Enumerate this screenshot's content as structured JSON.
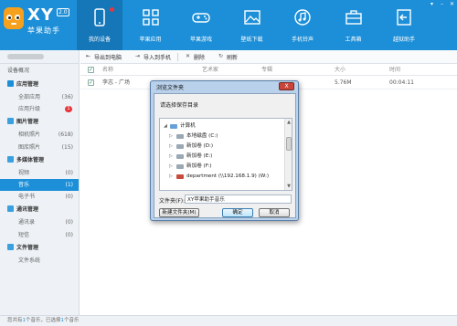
{
  "app": {
    "logo_name": "XY",
    "logo_version": "2.0",
    "logo_subtitle": "苹果助手"
  },
  "nav": [
    {
      "label": "我的设备",
      "icon": "phone-icon",
      "active": true
    },
    {
      "label": "苹果应用",
      "icon": "apps-grid-icon",
      "active": false
    },
    {
      "label": "苹果游戏",
      "icon": "gamepad-icon",
      "active": false
    },
    {
      "label": "壁纸下载",
      "icon": "image-icon",
      "active": false
    },
    {
      "label": "手机铃声",
      "icon": "music-note-icon",
      "active": false
    },
    {
      "label": "工具箱",
      "icon": "toolbox-icon",
      "active": false
    },
    {
      "label": "越狱助手",
      "icon": "exit-arrow-icon",
      "active": false
    }
  ],
  "sidebar": {
    "overview": "设备概况",
    "sections": [
      {
        "title": "应用管理",
        "items": [
          {
            "label": "全部应用",
            "count": "(36)"
          },
          {
            "label": "应用升级",
            "badge": "1"
          }
        ]
      },
      {
        "title": "图片管理",
        "items": [
          {
            "label": "相机照片",
            "count": "(618)"
          },
          {
            "label": "图库照片",
            "count": "(15)"
          }
        ]
      },
      {
        "title": "多媒体管理",
        "items": [
          {
            "label": "视频",
            "count": "(0)"
          },
          {
            "label": "音乐",
            "count": "(1)",
            "active": true
          },
          {
            "label": "电子书",
            "count": "(0)"
          }
        ]
      },
      {
        "title": "通讯管理",
        "items": [
          {
            "label": "通讯录",
            "count": "(0)"
          },
          {
            "label": "短信",
            "count": "(0)"
          }
        ]
      },
      {
        "title": "文件管理",
        "items": [
          {
            "label": "文件系统"
          }
        ]
      }
    ]
  },
  "toolbar": {
    "export_label": "导出到电脑",
    "import_label": "导入到手机",
    "delete_label": "删除",
    "refresh_label": "刷新"
  },
  "table": {
    "headers": {
      "name": "名称",
      "artist": "艺术家",
      "album": "专辑",
      "size": "大小",
      "time": "时间"
    },
    "rows": [
      {
        "name": "李志 - 广场",
        "size": "5.76M",
        "time": "00:04:11"
      }
    ]
  },
  "footer": {
    "prefix": "您共有",
    "total": "1",
    "middle": "个音乐，已选择",
    "selected": "1",
    "suffix": "个音乐"
  },
  "dialog": {
    "title": "浏览文件夹",
    "close_label": "X",
    "prompt": "请选择保存目录",
    "tree": [
      {
        "label": "计算机",
        "level": 0,
        "expanded": true,
        "icon": "computer-icon"
      },
      {
        "label": "本地磁盘 (C:)",
        "level": 1,
        "icon": "drive-icon"
      },
      {
        "label": "新加卷 (D:)",
        "level": 1,
        "icon": "drive-icon"
      },
      {
        "label": "新加卷 (E:)",
        "level": 1,
        "icon": "drive-icon"
      },
      {
        "label": "新加卷 (F:)",
        "level": 1,
        "icon": "drive-icon"
      },
      {
        "label": "department (\\\\192.168.1.9) (W:)",
        "level": 1,
        "icon": "network-drive-icon"
      }
    ],
    "folder_label": "文件夹(F):",
    "folder_value": "XY苹果助手音乐",
    "new_folder_label": "新建文件夹(M)",
    "ok_label": "确定",
    "cancel_label": "取消"
  },
  "colors": {
    "brand": "#1c8fd8",
    "accent_badge": "#e8363b",
    "logo": "#f5a11d"
  }
}
